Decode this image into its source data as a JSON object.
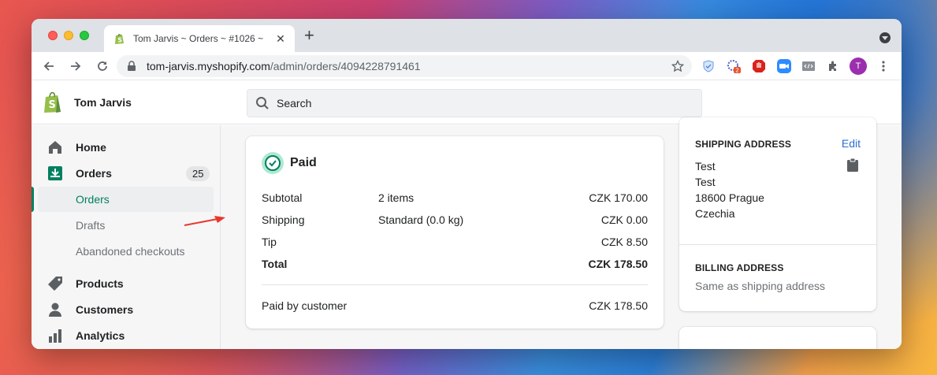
{
  "browser": {
    "tab_title": "Tom Jarvis ~ Orders ~ #1026 ~",
    "url_host": "tom-jarvis.myshopify.com",
    "url_path": "/admin/orders/4094228791461",
    "extension_badge": "2",
    "profile_initial": "T"
  },
  "shop": {
    "name": "Tom Jarvis",
    "search_placeholder": "Search"
  },
  "sidebar": {
    "items": [
      {
        "label": "Home",
        "icon": "home-icon"
      },
      {
        "label": "Orders",
        "icon": "orders-icon",
        "badge": "25"
      },
      {
        "label": "Orders",
        "sub": true,
        "active": true
      },
      {
        "label": "Drafts",
        "sub": true
      },
      {
        "label": "Abandoned checkouts",
        "sub": true
      },
      {
        "label": "Products",
        "icon": "tag-icon"
      },
      {
        "label": "Customers",
        "icon": "person-icon"
      },
      {
        "label": "Analytics",
        "icon": "bar-chart-icon"
      }
    ]
  },
  "payment": {
    "status": "Paid",
    "rows": [
      {
        "label": "Subtotal",
        "detail": "2 items",
        "amount": "CZK 170.00"
      },
      {
        "label": "Shipping",
        "detail": "Standard (0.0 kg)",
        "amount": "CZK 0.00"
      },
      {
        "label": "Tip",
        "detail": "",
        "amount": "CZK 8.50"
      },
      {
        "label": "Total",
        "detail": "",
        "amount": "CZK 178.50"
      }
    ],
    "paid_by_label": "Paid by customer",
    "paid_by_amount": "CZK 178.50"
  },
  "shipping_address": {
    "title": "SHIPPING ADDRESS",
    "edit_label": "Edit",
    "lines": [
      "Test",
      "Test",
      "18600 Prague",
      "Czechia"
    ]
  },
  "billing_address": {
    "title": "BILLING ADDRESS",
    "value": "Same as shipping address"
  },
  "colors": {
    "accent": "#008060",
    "link": "#2c6ecb",
    "annotation_arrow": "#e8382b"
  }
}
